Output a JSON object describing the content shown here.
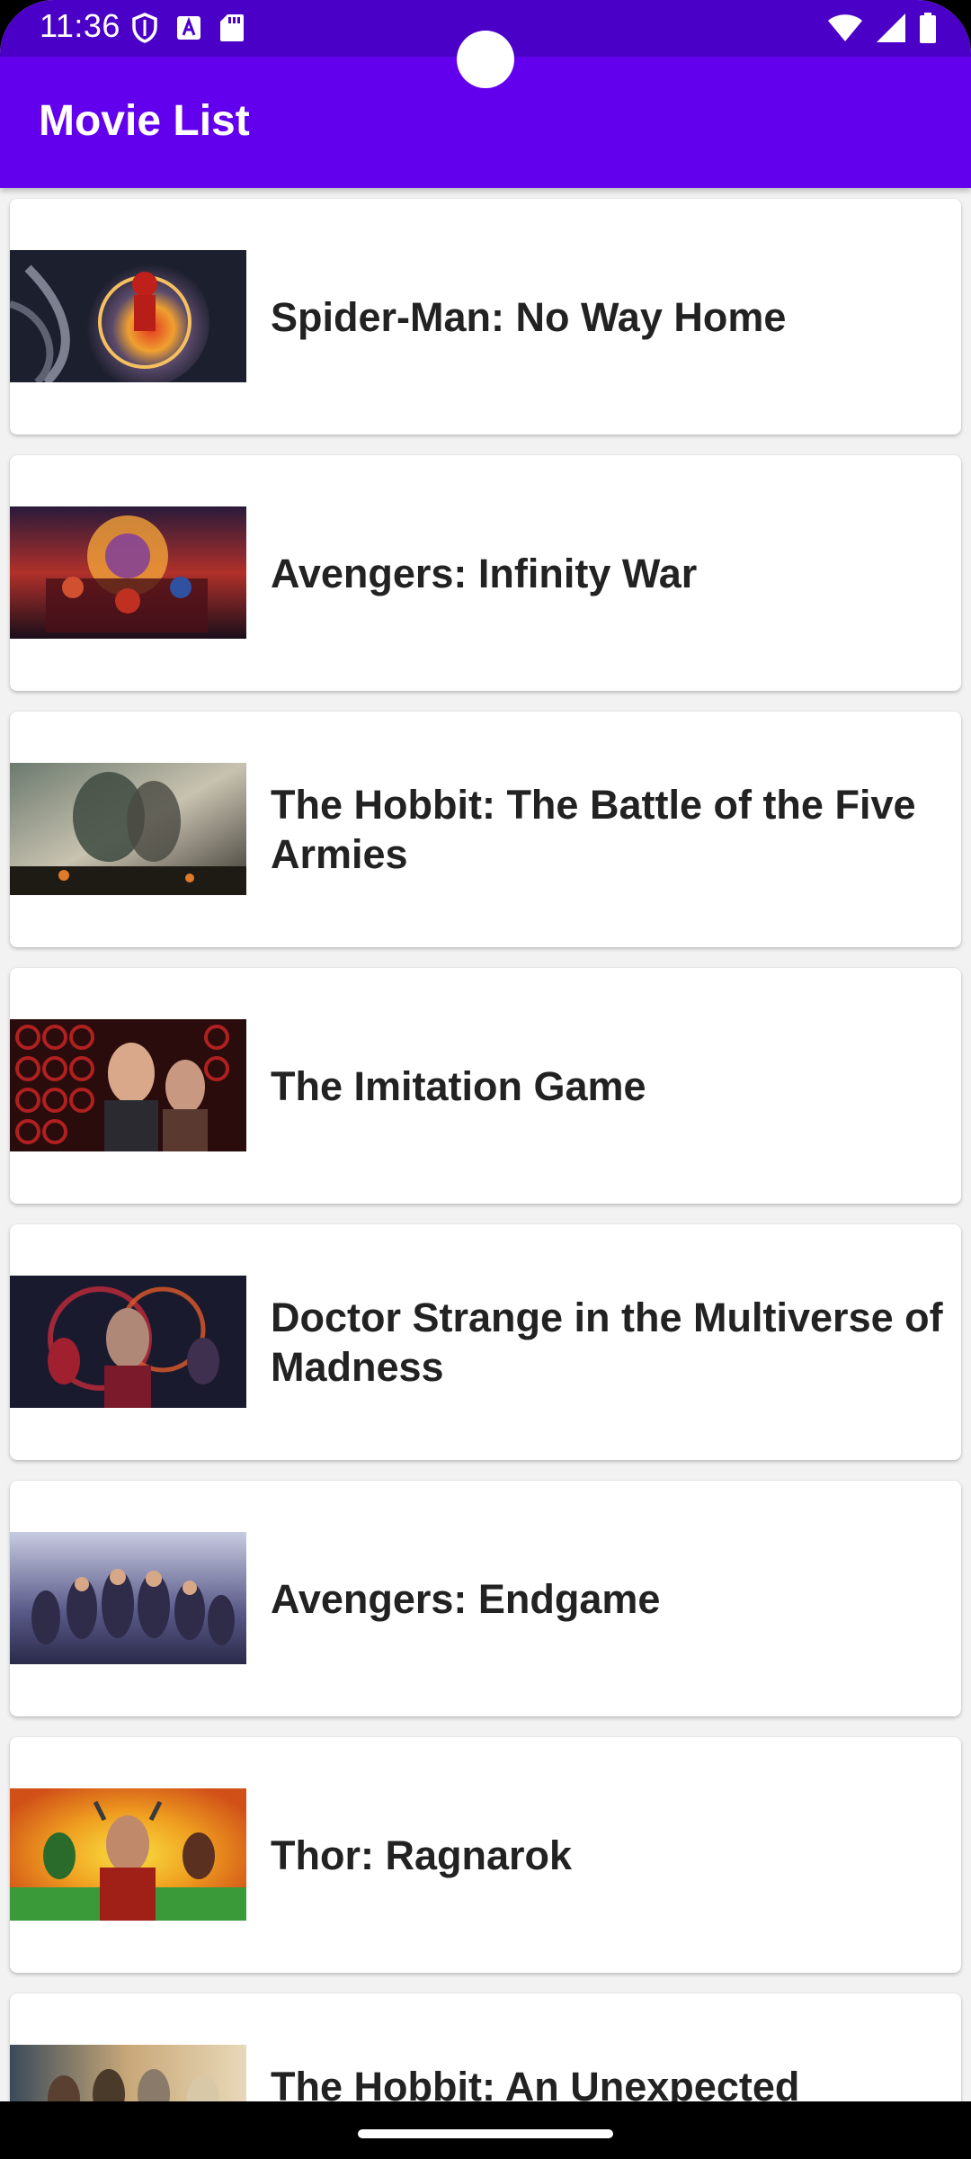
{
  "status_bar": {
    "time": "11:36",
    "left_icons": [
      "shield-icon",
      "a-notification-icon",
      "sd-card-icon"
    ],
    "right_icons": [
      "wifi-icon",
      "cellular-signal-icon",
      "battery-icon"
    ],
    "background": "#4b00c8"
  },
  "app_bar": {
    "title": "Movie List",
    "background": "#6200ee"
  },
  "movies": [
    {
      "title": "Spider-Man: No Way Home"
    },
    {
      "title": "Avengers: Infinity War"
    },
    {
      "title": "The Hobbit: The Battle of the Five Armies"
    },
    {
      "title": "The Imitation Game"
    },
    {
      "title": "Doctor Strange in the Multiverse of Madness"
    },
    {
      "title": "Avengers: Endgame"
    },
    {
      "title": "Thor: Ragnarok"
    },
    {
      "title": "The Hobbit: An Unexpected Journey"
    }
  ]
}
